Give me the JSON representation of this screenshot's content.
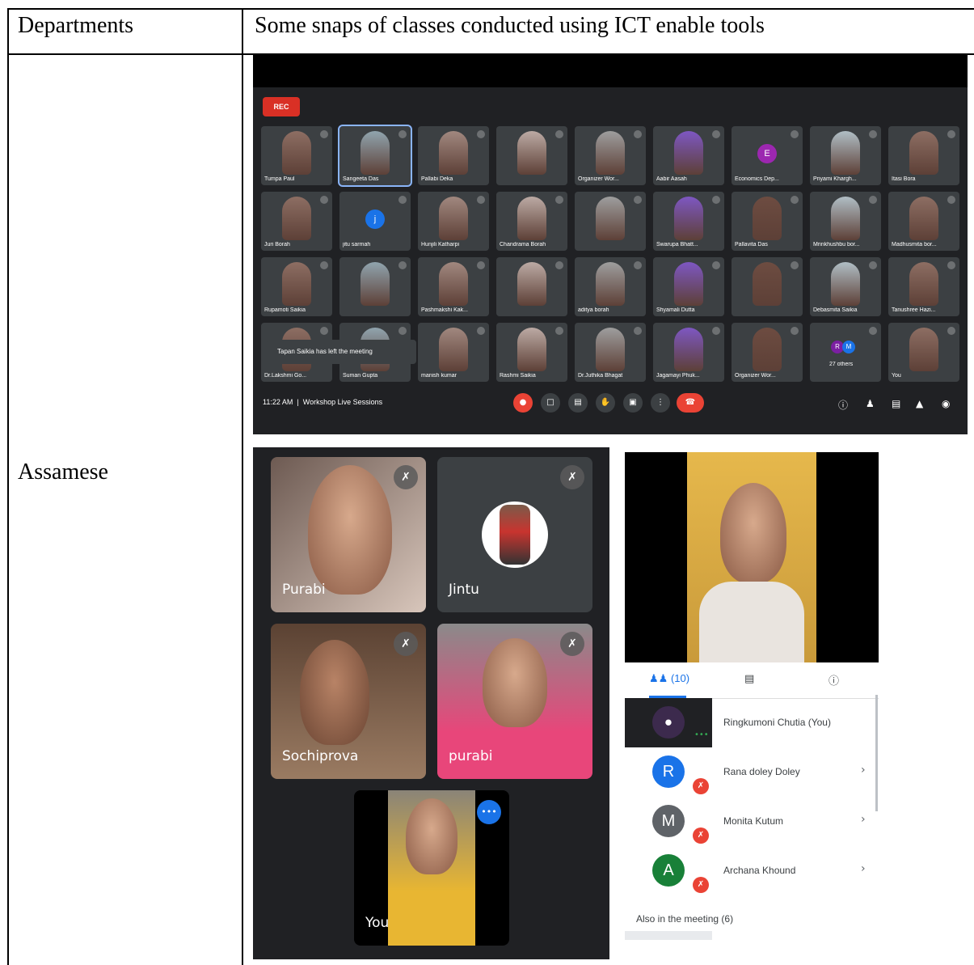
{
  "table": {
    "col1_header": "Departments",
    "col2_header": "Some snaps of classes conducted using ICT enable tools",
    "row_label": "Assamese"
  },
  "meet_grid": {
    "rec_label": "REC",
    "participants": [
      "Tumpa Paul",
      "Sangeeta Das",
      "Pallabi Deka",
      "",
      "Organizer Wor...",
      "Aabir Aasah",
      "Economics Dep...",
      "Priyami Khargh...",
      "Itasi Bora",
      "Juri Borah",
      "jitu sarmah",
      "Hunjili Katharpi",
      "Chandrama Borah",
      "",
      "Swarupa Bhatt...",
      "Pallavita Das",
      "Mrinkhushbu bor...",
      "Madhusmita bor...",
      "Rupamoti Saikia",
      "",
      "Pashmakshi Kak...",
      "",
      "aditya borah",
      "Shyamali Dutta",
      "",
      "Debasmita Saikia",
      "Tanushree Hazi...",
      "Dr.Lakshmi Go...",
      "Suman Gupta",
      "manish kumar",
      "Rashmi Saikia",
      "Dr.Juthika Bhagat",
      "Jagamayi Phuk...",
      "Organizer Wor...",
      "27 others",
      "You"
    ],
    "avatar_letters": {
      "economics": "E",
      "jitu": "j",
      "others_a": "R",
      "others_b": "M"
    },
    "toast": "Tapan Saikia has left the meeting",
    "time": "11:22 AM",
    "meeting_name": "Workshop Live Sessions"
  },
  "mobile_grid": {
    "tiles": [
      "Purabi",
      "Jintu",
      "Sochiprova",
      "purabi",
      "You"
    ]
  },
  "people_panel": {
    "people_tab": "(10)",
    "participants": [
      {
        "name": "Ringkumoni Chutia (You)",
        "letter": ""
      },
      {
        "name": "Rana doley Doley",
        "letter": "R"
      },
      {
        "name": "Monita Kutum",
        "letter": "M"
      },
      {
        "name": "Archana Khound",
        "letter": "A"
      }
    ],
    "also_header": "Also in the meeting (6)"
  }
}
